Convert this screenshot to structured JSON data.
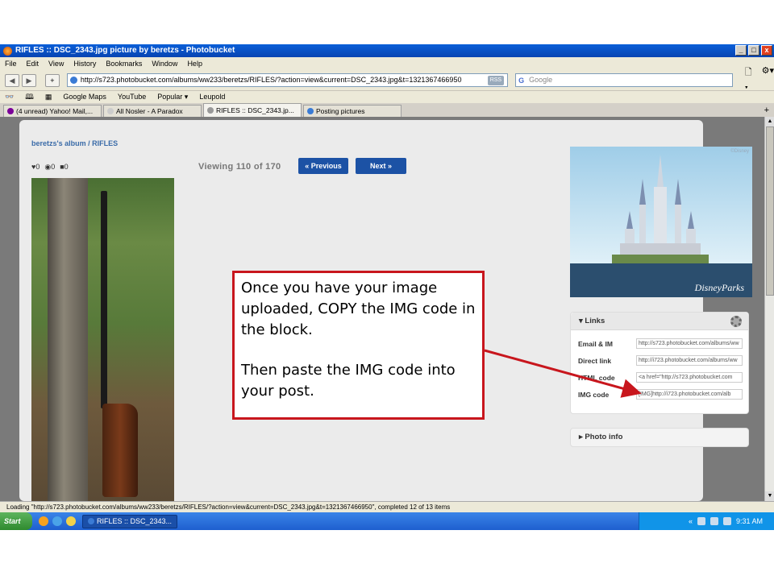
{
  "window": {
    "title": "RIFLES :: DSC_2343.jpg picture by beretzs - Photobucket",
    "buttons": [
      "_",
      "□",
      "x"
    ]
  },
  "menu": [
    "File",
    "Edit",
    "View",
    "History",
    "Bookmarks",
    "Window",
    "Help"
  ],
  "nav": {
    "url": "http://s723.photobucket.com/albums/ww233/beretzs/RIFLES/?action=view&current=DSC_2343.jpg&t=1321367466950",
    "rss": "RSS",
    "search_placeholder": "Google",
    "search_icon": "G"
  },
  "bookmarks": [
    "Google Maps",
    "YouTube",
    "Popular ▾",
    "Leupold"
  ],
  "tabs": [
    {
      "label": "(4 unread) Yahoo! Mail,...",
      "active": false
    },
    {
      "label": "All Nosler - A Paradox",
      "active": false
    },
    {
      "label": "RIFLES :: DSC_2343.jp...",
      "active": true
    },
    {
      "label": "Posting pictures",
      "active": false
    }
  ],
  "page": {
    "breadcrumb": "beretzs's album / RIFLES",
    "likes": "0",
    "views": "0",
    "comments": "0",
    "viewing": "Viewing 110 of 170",
    "prev_label": "« Previous",
    "next_label": "Next »"
  },
  "ad": {
    "brand": "DisneyParks",
    "tag": "©Disney"
  },
  "links": {
    "title": "Links",
    "rows": [
      {
        "label": "Email & IM",
        "value": "http://s723.photobucket.com/albums/ww"
      },
      {
        "label": "Direct link",
        "value": "http://i723.photobucket.com/albums/ww"
      },
      {
        "label": "HTML code",
        "value": "<a href=\"http://s723.photobucket.com"
      },
      {
        "label": "IMG code",
        "value": "[IMG]http://i723.photobucket.com/alb"
      }
    ]
  },
  "photo_info": "Photo info",
  "status": "Loading \"http://s723.photobucket.com/albums/ww233/beretzs/RIFLES/?action=view&current=DSC_2343.jpg&t=1321367466950\", completed 12 of 13 items",
  "taskbar": {
    "start": "Start",
    "task": "RIFLES :: DSC_2343...",
    "clock": "9:31 AM"
  },
  "callout": {
    "line1": "Once you have your image uploaded, COPY the IMG code in the block.",
    "line2": "Then paste the IMG code into your post."
  },
  "colors": {
    "callout_border": "#c8161d",
    "link_blue": "#3a6ba8",
    "nav_button": "#1c52a5"
  }
}
